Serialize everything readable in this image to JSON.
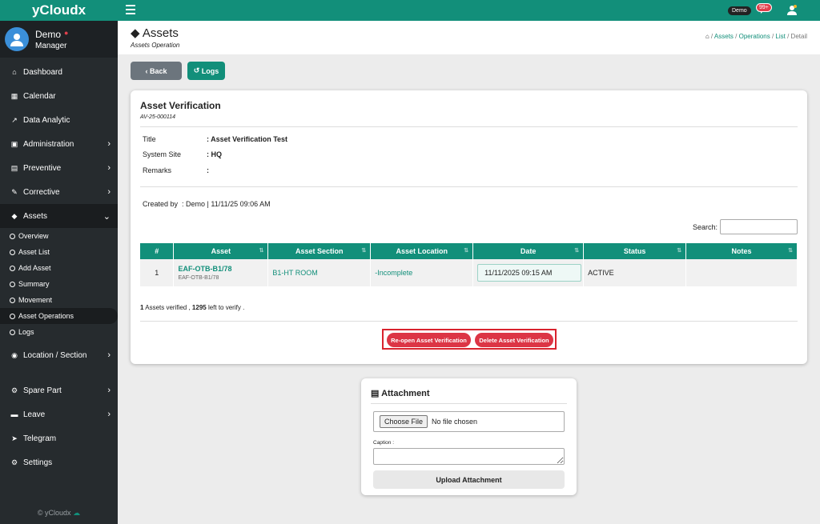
{
  "app": {
    "brand": "yCloudx",
    "footer": "© yCloudx"
  },
  "user": {
    "name": "Demo",
    "role": "Manager",
    "status_dot": "●"
  },
  "topbar": {
    "pill": "Demo",
    "badge": "99+"
  },
  "sidebar": {
    "items": [
      {
        "label": "Dashboard"
      },
      {
        "label": "Calendar"
      },
      {
        "label": "Data Analytic"
      },
      {
        "label": "Administration"
      },
      {
        "label": "Preventive"
      },
      {
        "label": "Corrective"
      },
      {
        "label": "Assets"
      }
    ],
    "sub_items": [
      {
        "label": "Overview"
      },
      {
        "label": "Asset List"
      },
      {
        "label": "Add Asset"
      },
      {
        "label": "Summary"
      },
      {
        "label": "Movement"
      },
      {
        "label": "Asset Operations"
      },
      {
        "label": "Logs"
      }
    ],
    "items2": [
      {
        "label": "Location / Section"
      },
      {
        "label": "Spare Part"
      },
      {
        "label": "Leave"
      },
      {
        "label": "Telegram"
      },
      {
        "label": "Settings"
      }
    ]
  },
  "header": {
    "title": "Assets",
    "subtitle": "Assets Operation",
    "breadcrumb": [
      "Assets",
      "Operations",
      "List",
      "Detail"
    ]
  },
  "buttons": {
    "back": "Back",
    "logs": "Logs"
  },
  "card": {
    "title": "Asset Verification",
    "code": "AV-25-000114",
    "details": [
      {
        "label": "Title",
        "value": ": Asset Verification Test"
      },
      {
        "label": "System Site",
        "value": ": HQ"
      },
      {
        "label": "Remarks",
        "value": ":"
      }
    ],
    "created_label": "Created by",
    "created_value": ":  Demo | 11/11/25 09:06 AM",
    "search_label": "Search:",
    "table": {
      "headers": [
        "#",
        "Asset",
        "Asset Section",
        "Asset Location",
        "Date",
        "Status",
        "Notes"
      ],
      "rows": [
        {
          "num": "1",
          "asset": "EAF-OTB-B1/78",
          "asset_sub": "EAF-OTB-B1/78",
          "section": "B1-HT ROOM",
          "location": "-Incomplete",
          "date": "11/11/2025 09:15 AM",
          "status": "ACTIVE",
          "notes": ""
        }
      ]
    },
    "summary": {
      "verified": "1",
      "mid": " Assets verified , ",
      "left": "1295",
      "tail": " left to verify ."
    },
    "actions": {
      "reopen": "Re-open Asset Verification",
      "delete": "Delete Asset Verification"
    }
  },
  "attachment": {
    "title": "Attachment",
    "choose_label": "Choose File",
    "file_status": "No file chosen",
    "caption_label": "Caption :",
    "upload_label": "Upload Attachment"
  }
}
